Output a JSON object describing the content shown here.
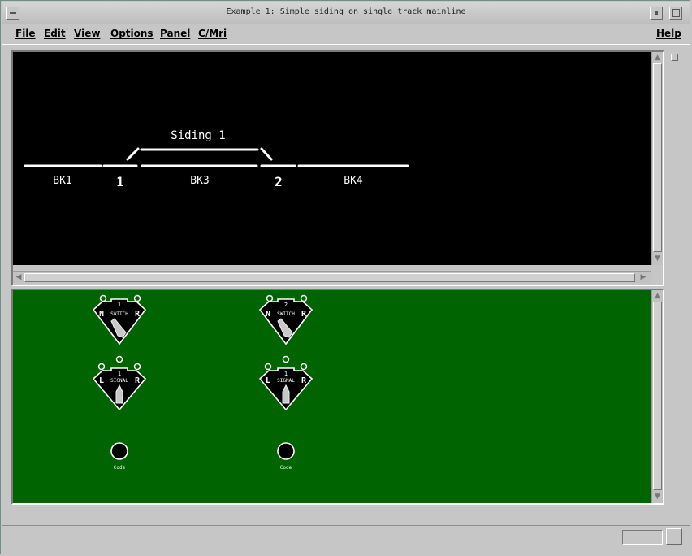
{
  "window": {
    "title": "Example 1: Simple siding on single track mainline"
  },
  "menu": {
    "items": [
      "File",
      "Edit",
      "View",
      "Options",
      "Panel",
      "C/Mri"
    ],
    "help": "Help"
  },
  "layout": {
    "siding_label": "Siding 1",
    "blocks": [
      "BK1",
      "BK3",
      "BK4"
    ],
    "turnouts": [
      "1",
      "2"
    ],
    "background": "#000000",
    "track_color": "#ffffff"
  },
  "panel": {
    "background": "#006400",
    "switch_levers": [
      {
        "number": "1",
        "left": "N",
        "word": "SWITCH",
        "right": "R"
      },
      {
        "number": "2",
        "left": "N",
        "word": "SWITCH",
        "right": "R"
      }
    ],
    "signal_levers": [
      {
        "number": "1",
        "left": "L",
        "word": "SIGNAL",
        "right": "R"
      },
      {
        "number": "1",
        "left": "L",
        "word": "SIGNAL",
        "right": "R"
      }
    ],
    "code_buttons": [
      {
        "label": "Code"
      },
      {
        "label": "Code"
      }
    ]
  }
}
